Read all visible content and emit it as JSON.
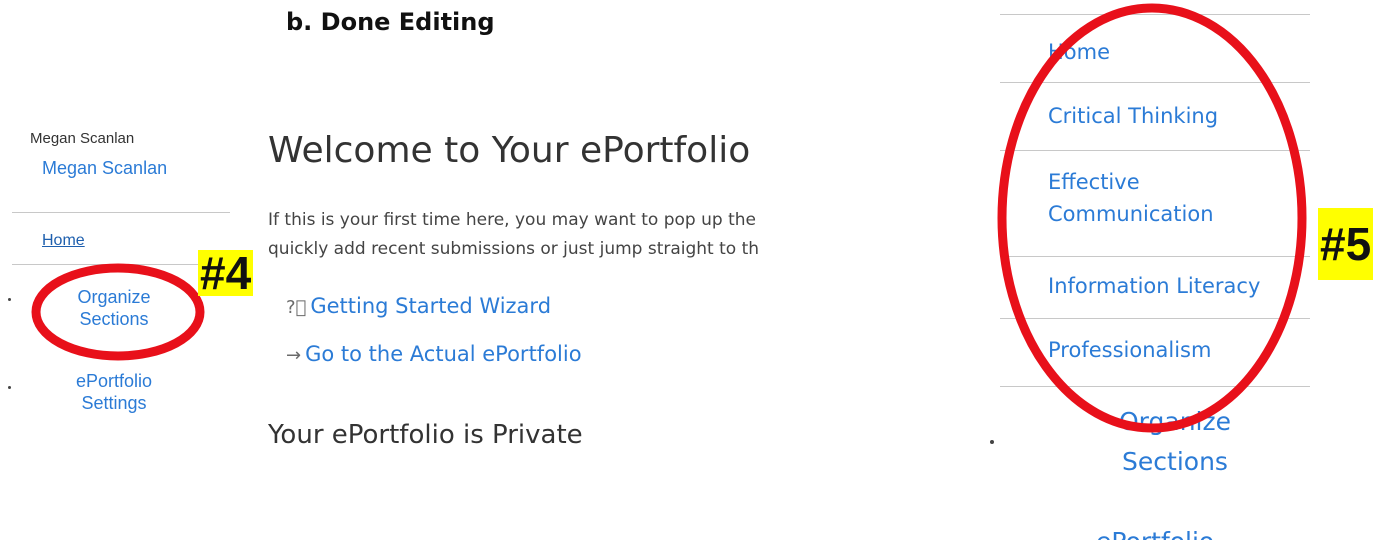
{
  "step": {
    "heading": "b.  Done Editing"
  },
  "sidebar": {
    "user_label": "Megan Scanlan",
    "user_link": "Megan Scanlan",
    "home": "Home",
    "organize_line1": "Organize",
    "organize_line2": "Sections",
    "settings_line1": "ePortfolio",
    "settings_line2": "Settings"
  },
  "main": {
    "title": "Welcome to Your ePortfolio",
    "intro_line1": "If this is your first time here, you may want to pop up the",
    "intro_line2": "quickly add recent submissions or just jump straight to th",
    "wizard_icon": "help-circle-icon",
    "wizard_label": "Getting Started Wizard",
    "go_icon": "arrow-right-icon",
    "go_label": "Go to the Actual ePortfolio",
    "private_heading": "Your ePortfolio is Private"
  },
  "annotations": {
    "tag4": "#4",
    "tag5": "#5",
    "highlight_color": "#ffff00",
    "circle_color": "#e8101a"
  },
  "right_nav": {
    "items": [
      "Home",
      "Critical Thinking",
      "Effective",
      "Communication",
      "Information Literacy",
      "Professionalism"
    ],
    "organize_line1": "Organize",
    "organize_line2": "Sections",
    "eportfolio_partial": "ePortfolio"
  }
}
